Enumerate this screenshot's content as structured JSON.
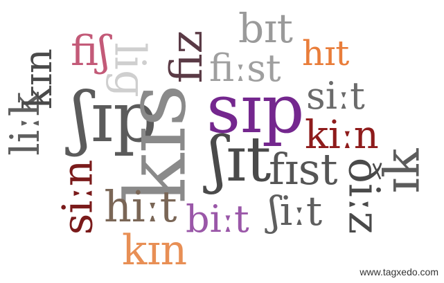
{
  "words": [
    {
      "id": "fis",
      "text": "fiʃ",
      "color": "#c35a78"
    },
    {
      "id": "lig",
      "text": "liɡ",
      "color": "#cfcfcf"
    },
    {
      "id": "fiz",
      "text": "fiz",
      "color": "#5a3a45"
    },
    {
      "id": "bit",
      "text": "bɪt",
      "color": "#9a9a9a"
    },
    {
      "id": "hit",
      "text": "hɪt",
      "color": "#e97d3a"
    },
    {
      "id": "kin",
      "text": "kɪn",
      "color": "#4a4a4a"
    },
    {
      "id": "likk",
      "text": "liːk",
      "color": "#5f5f5f"
    },
    {
      "id": "ship",
      "text": "ʃɪp",
      "color": "#5b5b5b"
    },
    {
      "id": "kis",
      "text": "kɪs",
      "color": "#8a8a8a"
    },
    {
      "id": "fiist",
      "text": "fiːst",
      "color": "#9f9f9f"
    },
    {
      "id": "sip",
      "text": "sɪp",
      "color": "#74278e"
    },
    {
      "id": "siit",
      "text": "siːt",
      "color": "#6b6b6b"
    },
    {
      "id": "kiin",
      "text": "kiːn",
      "color": "#8e1b1b"
    },
    {
      "id": "ik",
      "text": "ɪk",
      "color": "#5c5c5c"
    },
    {
      "id": "sit",
      "text": "ʃɪt",
      "color": "#4a4a4a"
    },
    {
      "id": "fist",
      "text": "fɪst",
      "color": "#555555"
    },
    {
      "id": "siin",
      "text": "siːn",
      "color": "#7a1a1a"
    },
    {
      "id": "hiit",
      "text": "hiːt",
      "color": "#7a6656"
    },
    {
      "id": "biit",
      "text": "biːt",
      "color": "#9a57a8"
    },
    {
      "id": "shiit",
      "text": "ʃiːt",
      "color": "#5f5f5f"
    },
    {
      "id": "dhiiz",
      "text": "ðiːz",
      "color": "#4a4a4a"
    },
    {
      "id": "kin2",
      "text": "kɪn",
      "color": "#e88f55"
    }
  ],
  "watermark": "www.tagxedo.com"
}
